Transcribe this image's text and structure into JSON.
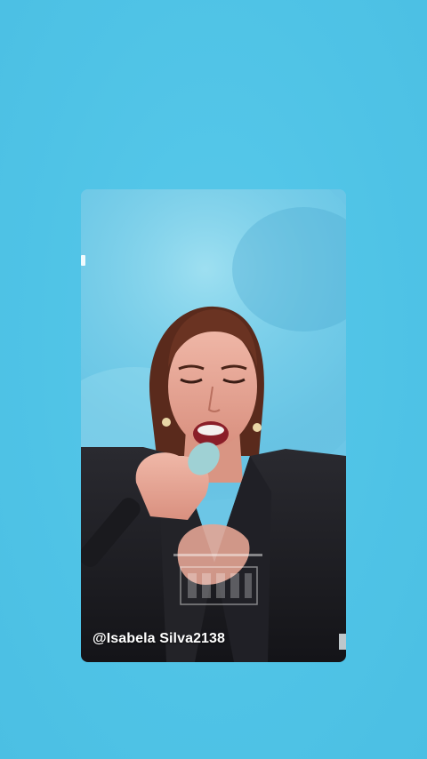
{
  "video": {
    "watermark_handle": "@Isabela Silva2138"
  },
  "colors": {
    "background": "#50c4e6",
    "card_sky": "#7fd0ea",
    "jacket": "#1e1e22",
    "skin": "#e8a89a",
    "hair": "#5a2a1c"
  }
}
